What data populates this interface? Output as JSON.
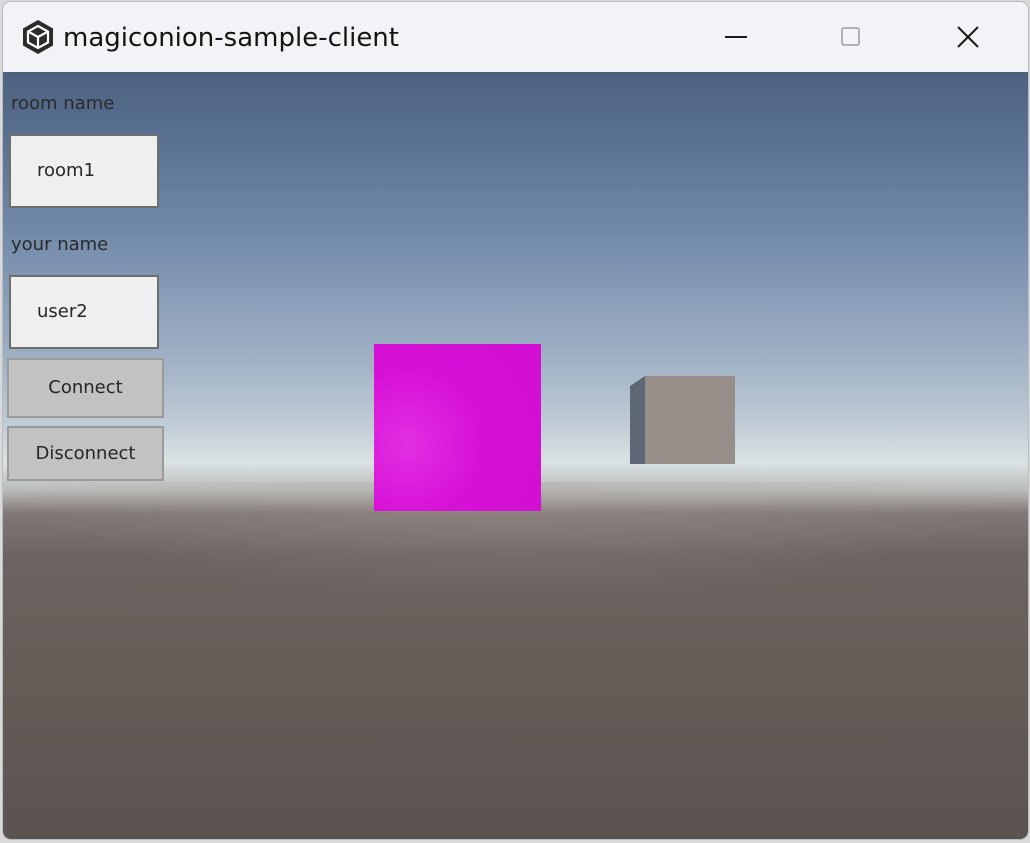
{
  "window": {
    "title": "magiconion-sample-client",
    "controls": {
      "minimize": "minimize-icon",
      "maximize": "maximize-icon",
      "close": "close-icon"
    }
  },
  "form": {
    "room_label": "room name",
    "room_value": "room1",
    "name_label": "your name",
    "name_value": "user2",
    "connect_label": "Connect",
    "disconnect_label": "Disconnect"
  },
  "scene": {
    "objects": [
      {
        "kind": "cube",
        "color": "#d30ed3"
      },
      {
        "kind": "cube",
        "color": "#978d89"
      }
    ]
  }
}
